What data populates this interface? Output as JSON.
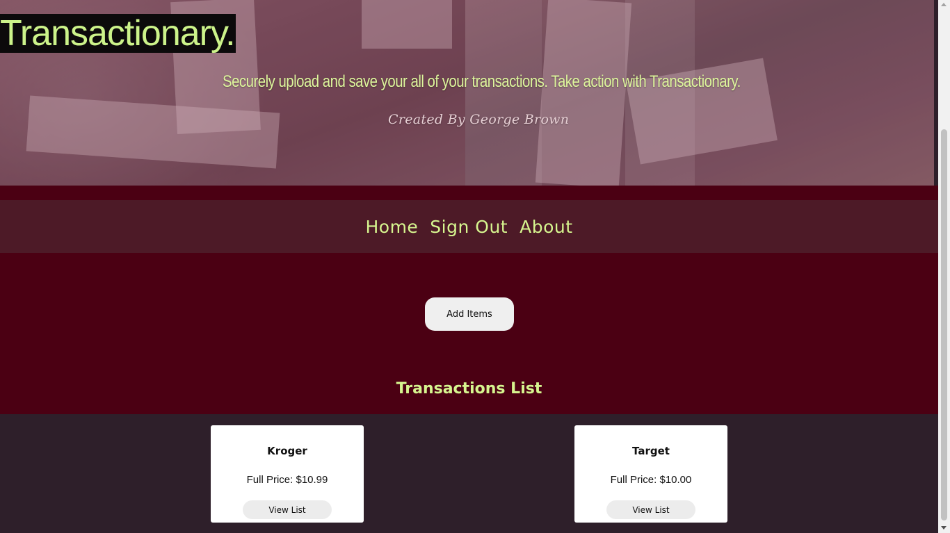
{
  "hero": {
    "brand": "Transactionary.",
    "tagline": "Securely upload and save your all of your transactions. Take action with Transactionary.",
    "credit": "Created By George Brown"
  },
  "nav": {
    "items": [
      {
        "label": "Home"
      },
      {
        "label": "Sign Out"
      },
      {
        "label": "About"
      }
    ]
  },
  "main": {
    "add_button": "Add Items",
    "section_title": "Transactions List"
  },
  "transactions": [
    {
      "store": "Kroger",
      "price": "Full Price: $10.99",
      "button": "View List"
    },
    {
      "store": "Target",
      "price": "Full Price: $10.00",
      "button": "View List"
    }
  ],
  "colors": {
    "accent": "#d6f58f",
    "maroon": "#4b0013",
    "nav_bg": "#4d1a27",
    "list_bg": "#2e1f2a"
  }
}
